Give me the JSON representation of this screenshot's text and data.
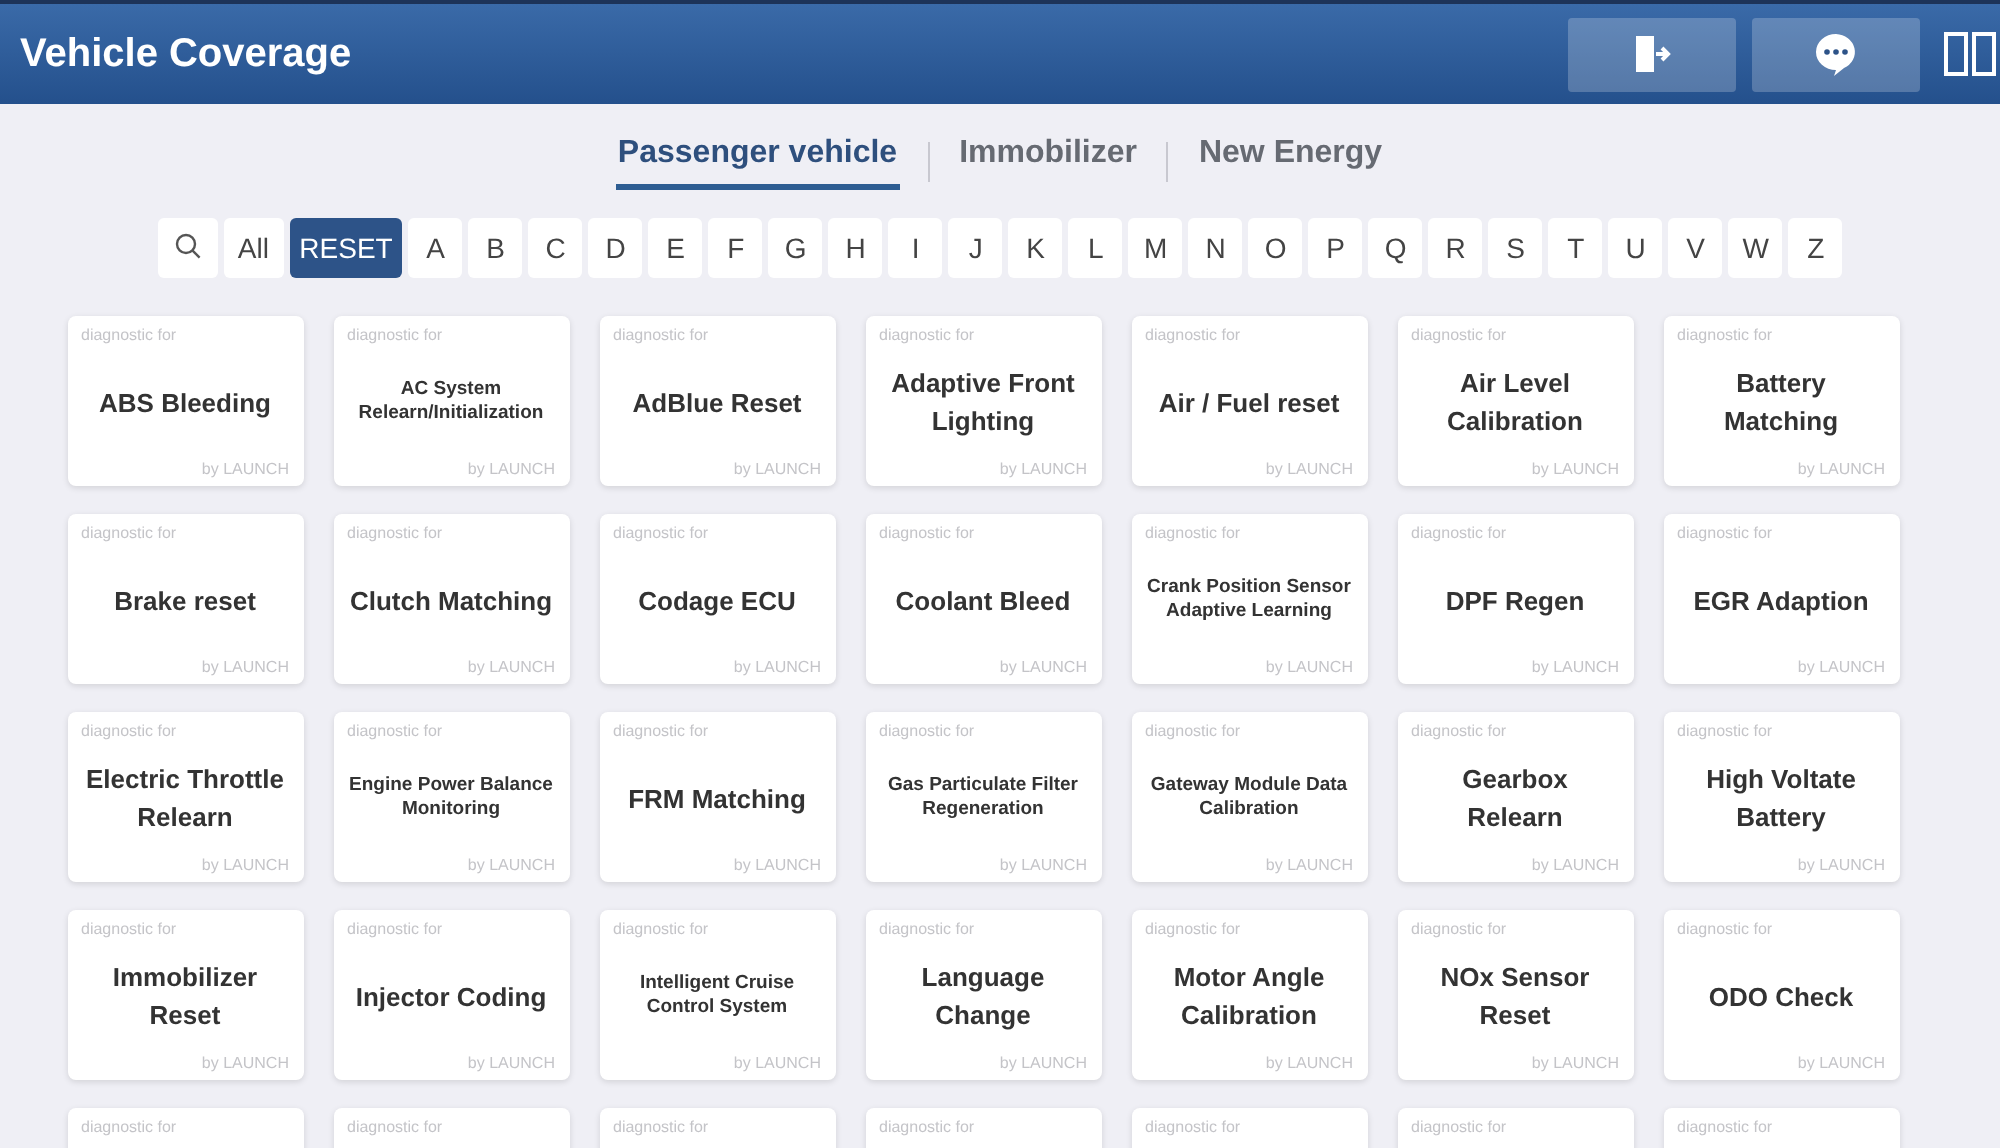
{
  "header": {
    "title": "Vehicle Coverage"
  },
  "tabs": [
    {
      "label": "Passenger vehicle",
      "selected": true
    },
    {
      "label": "Immobilizer",
      "selected": false
    },
    {
      "label": "New Energy",
      "selected": false
    }
  ],
  "filters": [
    {
      "label": "All",
      "selected": false
    },
    {
      "label": "RESET",
      "selected": true
    },
    {
      "label": "A",
      "selected": false
    },
    {
      "label": "B",
      "selected": false
    },
    {
      "label": "C",
      "selected": false
    },
    {
      "label": "D",
      "selected": false
    },
    {
      "label": "E",
      "selected": false
    },
    {
      "label": "F",
      "selected": false
    },
    {
      "label": "G",
      "selected": false
    },
    {
      "label": "H",
      "selected": false
    },
    {
      "label": "I",
      "selected": false
    },
    {
      "label": "J",
      "selected": false
    },
    {
      "label": "K",
      "selected": false
    },
    {
      "label": "L",
      "selected": false
    },
    {
      "label": "M",
      "selected": false
    },
    {
      "label": "N",
      "selected": false
    },
    {
      "label": "O",
      "selected": false
    },
    {
      "label": "P",
      "selected": false
    },
    {
      "label": "Q",
      "selected": false
    },
    {
      "label": "R",
      "selected": false
    },
    {
      "label": "S",
      "selected": false
    },
    {
      "label": "T",
      "selected": false
    },
    {
      "label": "U",
      "selected": false
    },
    {
      "label": "V",
      "selected": false
    },
    {
      "label": "W",
      "selected": false
    },
    {
      "label": "Z",
      "selected": false
    }
  ],
  "cards": [
    {
      "caption": "diagnostic for",
      "title": "ABS Bleeding",
      "kind": "large",
      "footer": "by LAUNCH"
    },
    {
      "caption": "diagnostic for",
      "title": "AC System\nRelearn/Initialization",
      "kind": "compact",
      "footer": "by LAUNCH"
    },
    {
      "caption": "diagnostic for",
      "title": "AdBlue Reset",
      "kind": "large",
      "footer": "by LAUNCH"
    },
    {
      "caption": "diagnostic for",
      "title": "Adaptive Front\nLighting",
      "kind": "large",
      "footer": "by LAUNCH"
    },
    {
      "caption": "diagnostic for",
      "title": "Air / Fuel reset",
      "kind": "large",
      "footer": "by LAUNCH"
    },
    {
      "caption": "diagnostic for",
      "title": "Air Level\nCalibration",
      "kind": "large",
      "footer": "by LAUNCH"
    },
    {
      "caption": "diagnostic for",
      "title": "Battery Matching",
      "kind": "large",
      "footer": "by LAUNCH"
    },
    {
      "caption": "diagnostic for",
      "title": "Brake reset",
      "kind": "large",
      "footer": "by LAUNCH"
    },
    {
      "caption": "diagnostic for",
      "title": "Clutch Matching",
      "kind": "large",
      "footer": "by LAUNCH"
    },
    {
      "caption": "diagnostic for",
      "title": "Codage ECU",
      "kind": "large",
      "footer": "by LAUNCH"
    },
    {
      "caption": "diagnostic for",
      "title": "Coolant Bleed",
      "kind": "large",
      "footer": "by LAUNCH"
    },
    {
      "caption": "diagnostic for",
      "title": "Crank Position Sensor\nAdaptive Learning",
      "kind": "compact",
      "footer": "by LAUNCH"
    },
    {
      "caption": "diagnostic for",
      "title": "DPF Regen",
      "kind": "large",
      "footer": "by LAUNCH"
    },
    {
      "caption": "diagnostic for",
      "title": "EGR Adaption",
      "kind": "large",
      "footer": "by LAUNCH"
    },
    {
      "caption": "diagnostic for",
      "title": "Electric Throttle\nRelearn",
      "kind": "large",
      "footer": "by LAUNCH"
    },
    {
      "caption": "diagnostic for",
      "title": "Engine Power Balance\nMonitoring",
      "kind": "compact",
      "footer": "by LAUNCH"
    },
    {
      "caption": "diagnostic for",
      "title": "FRM Matching",
      "kind": "large",
      "footer": "by LAUNCH"
    },
    {
      "caption": "diagnostic for",
      "title": "Gas Particulate Filter\nRegeneration",
      "kind": "compact",
      "footer": "by LAUNCH"
    },
    {
      "caption": "diagnostic for",
      "title": "Gateway Module Data\nCalibration",
      "kind": "compact",
      "footer": "by LAUNCH"
    },
    {
      "caption": "diagnostic for",
      "title": "Gearbox Relearn",
      "kind": "large",
      "footer": "by LAUNCH"
    },
    {
      "caption": "diagnostic for",
      "title": "High Voltate\nBattery",
      "kind": "large",
      "footer": "by LAUNCH"
    },
    {
      "caption": "diagnostic for",
      "title": "Immobilizer\nReset",
      "kind": "large",
      "footer": "by LAUNCH"
    },
    {
      "caption": "diagnostic for",
      "title": "Injector Coding",
      "kind": "large",
      "footer": "by LAUNCH"
    },
    {
      "caption": "diagnostic for",
      "title": "Intelligent Cruise\nControl System",
      "kind": "compact",
      "footer": "by LAUNCH"
    },
    {
      "caption": "diagnostic for",
      "title": "Language\nChange",
      "kind": "large",
      "footer": "by LAUNCH"
    },
    {
      "caption": "diagnostic for",
      "title": "Motor Angle\nCalibration",
      "kind": "large",
      "footer": "by LAUNCH"
    },
    {
      "caption": "diagnostic for",
      "title": "NOx Sensor\nReset",
      "kind": "large",
      "footer": "by LAUNCH"
    },
    {
      "caption": "diagnostic for",
      "title": "ODO Check",
      "kind": "large",
      "footer": "by LAUNCH"
    },
    {
      "caption": "diagnostic for"
    },
    {
      "caption": "diagnostic for"
    },
    {
      "caption": "diagnostic for"
    },
    {
      "caption": "diagnostic for"
    },
    {
      "caption": "diagnostic for"
    },
    {
      "caption": "diagnostic for"
    },
    {
      "caption": "diagnostic for"
    }
  ]
}
